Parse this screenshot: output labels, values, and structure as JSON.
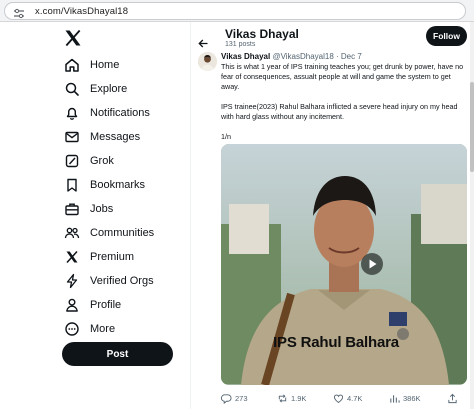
{
  "browser": {
    "url": "x.com/VikasDhayal18"
  },
  "sidebar": {
    "items": [
      {
        "label": "Home",
        "icon": "home-icon"
      },
      {
        "label": "Explore",
        "icon": "search-icon"
      },
      {
        "label": "Notifications",
        "icon": "bell-icon"
      },
      {
        "label": "Messages",
        "icon": "mail-icon"
      },
      {
        "label": "Grok",
        "icon": "grok-icon"
      },
      {
        "label": "Bookmarks",
        "icon": "bookmark-icon"
      },
      {
        "label": "Jobs",
        "icon": "briefcase-icon"
      },
      {
        "label": "Communities",
        "icon": "people-icon"
      },
      {
        "label": "Premium",
        "icon": "x-logo-icon"
      },
      {
        "label": "Verified Orgs",
        "icon": "lightning-icon"
      },
      {
        "label": "Profile",
        "icon": "user-icon"
      },
      {
        "label": "More",
        "icon": "more-circle-icon"
      }
    ],
    "post_label": "Post"
  },
  "header": {
    "name": "Vikas Dhayal",
    "posts": "131 posts",
    "follow_label": "Follow"
  },
  "tweet": {
    "name": "Vikas Dhayal",
    "handle_date": "@VikasDhayal18 · Dec 7",
    "paragraphs": [
      "This is what 1 year of IPS training teaches you; get drunk by power, have no fear of consequences, assualt people at will and game the system to get away.",
      "IPS trainee(2023) Rahul Balhara inflicted a severe head injury on my head with hard glass without any incitement.",
      "1/n"
    ],
    "media_overlay": "IPS Rahul Balhara",
    "stats": {
      "replies": "273",
      "reposts": "1.9K",
      "likes": "4.7K",
      "views": "386K"
    }
  },
  "colors": {
    "text": "#0f1419",
    "muted": "#536471",
    "button_dark": "#0f1419",
    "overlay_yellow": "#f5d25a"
  }
}
